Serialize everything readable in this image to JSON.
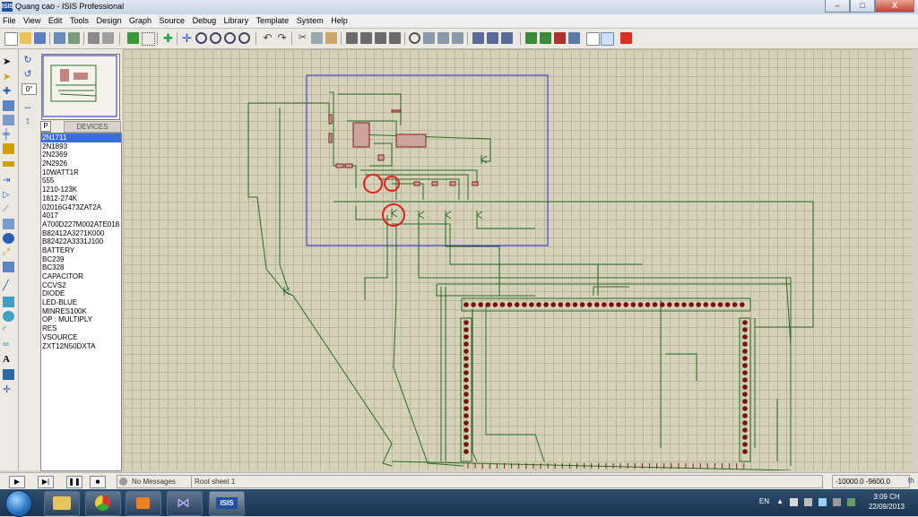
{
  "window": {
    "title": "Quang cao - ISIS Professional",
    "app_icon": "ISIS",
    "controls": [
      "–",
      "□",
      "X"
    ]
  },
  "menu": [
    "File",
    "View",
    "Edit",
    "Tools",
    "Design",
    "Graph",
    "Source",
    "Debug",
    "Library",
    "Template",
    "System",
    "Help"
  ],
  "panel": {
    "tab_p": "P",
    "tab_l": "L",
    "devices_header": "DEVICES",
    "angle_value": "0°"
  },
  "devices": [
    "2N1711",
    "2N1893",
    "2N2369",
    "2N2926",
    "10WATT1R",
    "555",
    "1210-123K",
    "1812-274K",
    "02016G473ZAT2A",
    "4017",
    "A700D227M002ATE018",
    "B82412A3271K000",
    "B82422A3331J100",
    "BATTERY",
    "BC239",
    "BC328",
    "CAPACITOR",
    "CCVS2",
    "DIODE",
    "LED-BLUE",
    "MINRES100K",
    "OP : MULTIPLY",
    "RES",
    "VSOURCE",
    "ZXT12N50DXTA"
  ],
  "selected_device": "2N1711",
  "status": {
    "messages": "No Messages",
    "sheet": "Root sheet 1",
    "coord_x": "-10000.0",
    "coord_y": "-9600.0",
    "units": "th"
  },
  "tray": {
    "lang": "EN",
    "time": "3:09 CH",
    "date": "22/09/2013"
  },
  "colors": {
    "wire": "#2c6b2c",
    "component": "#8b1a1a",
    "grid_bg": "#d4d2b7",
    "sheet_border": "#2a2ad0",
    "highlight": "#e02020"
  }
}
